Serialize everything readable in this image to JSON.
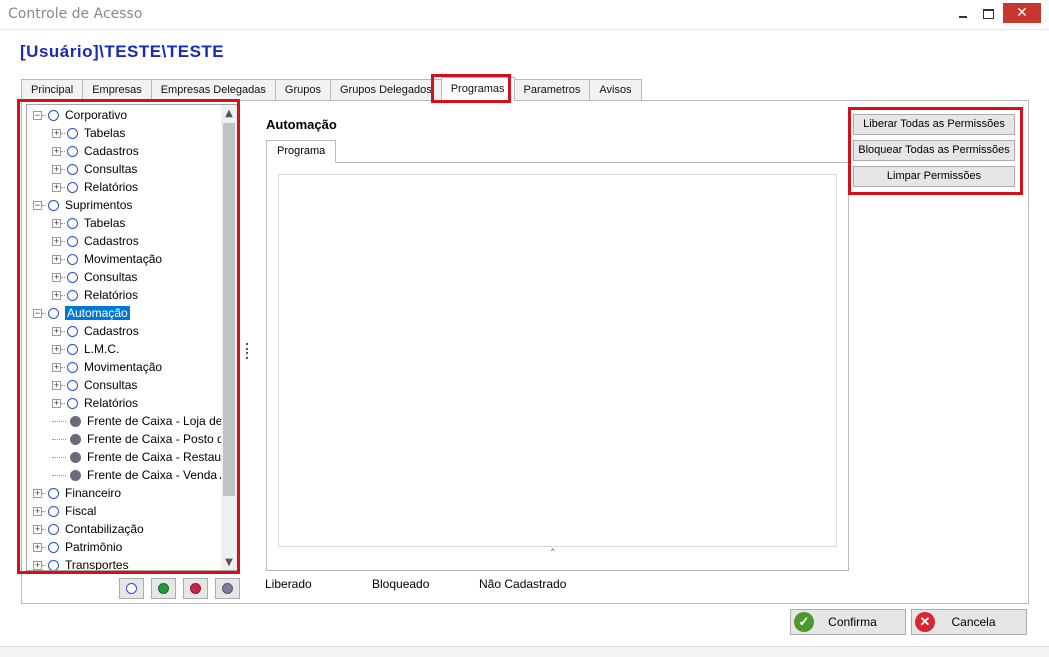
{
  "window": {
    "title": "Controle de Acesso",
    "user_path": "[Usuário]\\TESTE\\TESTE"
  },
  "tabs": [
    {
      "label": "Principal"
    },
    {
      "label": "Empresas"
    },
    {
      "label": "Empresas Delegadas"
    },
    {
      "label": "Grupos"
    },
    {
      "label": "Grupos Delegados"
    },
    {
      "label": "Programas",
      "active": true
    },
    {
      "label": "Parametros"
    },
    {
      "label": "Avisos"
    }
  ],
  "tree": {
    "items": [
      {
        "label": "Corporativo",
        "level": 0,
        "expanded": true,
        "icon": "circle-blue"
      },
      {
        "label": "Tabelas",
        "level": 1,
        "icon": "circle-blue"
      },
      {
        "label": "Cadastros",
        "level": 1,
        "icon": "circle-blue"
      },
      {
        "label": "Consultas",
        "level": 1,
        "icon": "circle-blue"
      },
      {
        "label": "Relatórios",
        "level": 1,
        "icon": "circle-blue"
      },
      {
        "label": "Suprimentos",
        "level": 0,
        "expanded": true,
        "icon": "circle-blue"
      },
      {
        "label": "Tabelas",
        "level": 1,
        "icon": "circle-blue"
      },
      {
        "label": "Cadastros",
        "level": 1,
        "icon": "circle-blue"
      },
      {
        "label": "Movimentação",
        "level": 1,
        "icon": "circle-blue"
      },
      {
        "label": "Consultas",
        "level": 1,
        "icon": "circle-blue"
      },
      {
        "label": "Relatórios",
        "level": 1,
        "icon": "circle-blue"
      },
      {
        "label": "Automação",
        "level": 0,
        "expanded": true,
        "selected": true,
        "icon": "circle-blue"
      },
      {
        "label": "Cadastros",
        "level": 1,
        "icon": "circle-blue"
      },
      {
        "label": "L.M.C.",
        "level": 1,
        "icon": "circle-blue"
      },
      {
        "label": "Movimentação",
        "level": 1,
        "icon": "circle-blue"
      },
      {
        "label": "Consultas",
        "level": 1,
        "icon": "circle-blue"
      },
      {
        "label": "Relatórios",
        "level": 1,
        "icon": "circle-blue"
      },
      {
        "label": "Frente de Caixa - Loja de",
        "level": 1,
        "leaf": true,
        "icon": "circle-gray"
      },
      {
        "label": "Frente de Caixa - Posto d",
        "level": 1,
        "leaf": true,
        "icon": "circle-gray"
      },
      {
        "label": "Frente de Caixa - Restaura",
        "level": 1,
        "leaf": true,
        "icon": "circle-gray"
      },
      {
        "label": "Frente de Caixa - Venda A",
        "level": 1,
        "leaf": true,
        "icon": "circle-gray"
      },
      {
        "label": "Financeiro",
        "level": 0,
        "expanded": false,
        "icon": "circle-blue"
      },
      {
        "label": "Fiscal",
        "level": 0,
        "expanded": false,
        "icon": "circle-blue"
      },
      {
        "label": "Contabilização",
        "level": 0,
        "expanded": false,
        "icon": "circle-blue"
      },
      {
        "label": "Patrimônio",
        "level": 0,
        "expanded": false,
        "icon": "circle-blue"
      },
      {
        "label": "Transportes",
        "level": 0,
        "expanded": false,
        "icon": "circle-blue"
      }
    ]
  },
  "legend_buttons": [
    {
      "name": "nao-cadastrado",
      "color": "#ffffff",
      "border": "#2b4fc7"
    },
    {
      "name": "liberado",
      "color": "#1f9a3a",
      "border": "#1f6b2c"
    },
    {
      "name": "bloqueado",
      "color": "#c2264e",
      "border": "#8a1a36"
    },
    {
      "name": "neutral",
      "color": "#7a7f9a",
      "border": "#55596e"
    }
  ],
  "main": {
    "section_title": "Automação",
    "inner_tab": "Programa"
  },
  "actions": {
    "liberar": "Liberar Todas as Permissões",
    "bloquear": "Bloquear Todas as Permissões",
    "limpar": "Limpar Permissões"
  },
  "legend": {
    "liberado": "Liberado",
    "bloqueado": "Bloqueado",
    "nao_cadastrado": "Não Cadastrado"
  },
  "footer": {
    "confirma": "Confirma",
    "cancela": "Cancela"
  },
  "colors": {
    "highlight_red": "#d6101a",
    "selection_blue": "#0078d7",
    "title_blue": "#1a2bb3"
  }
}
